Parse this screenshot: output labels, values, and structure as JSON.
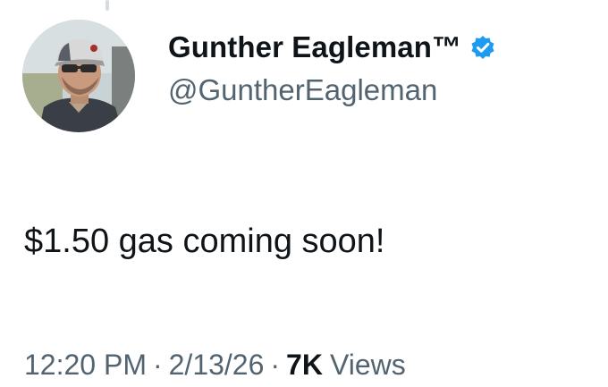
{
  "tweet": {
    "author": {
      "display_name": "Gunther Eagleman™",
      "handle": "@GuntherEagleman",
      "verified": true,
      "verified_color": "#1d9bf0",
      "avatar_icon": "profile-photo-man-in-cap"
    },
    "text": "$1.50 gas coming soon!",
    "meta": {
      "time": "12:20 PM",
      "separator": "·",
      "date": "2/13/26",
      "views_count": "7K",
      "views_label": "Views"
    }
  }
}
